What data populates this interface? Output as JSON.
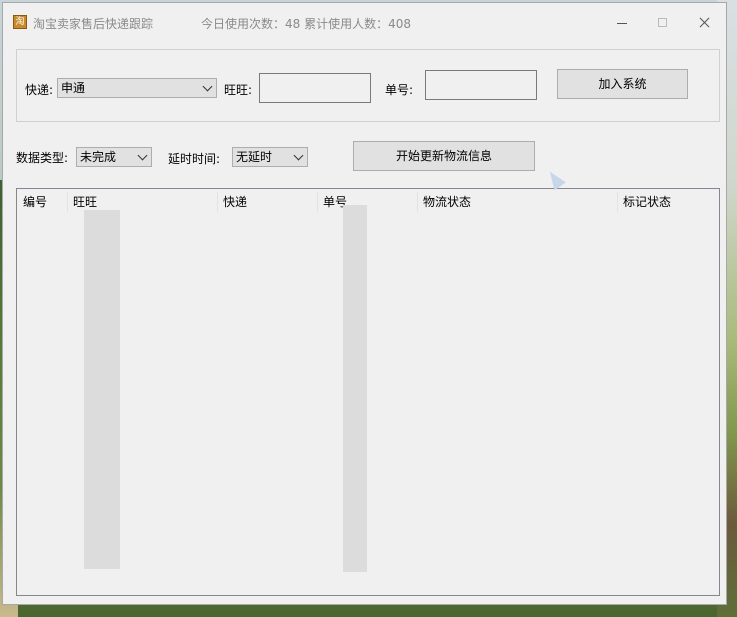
{
  "window": {
    "icon_glyph": "淘",
    "title": "淘宝卖家售后快递跟踪",
    "stats": "今日使用次数：48   累计使用人数：408",
    "controls": [
      "minimize-icon",
      "maximize-icon",
      "close-icon"
    ]
  },
  "form": {
    "express_label": "快递:",
    "express_value": "申通",
    "wangwang_label": "旺旺:",
    "wangwang_value": "",
    "tracking_label": "单号:",
    "tracking_value": "",
    "add_button": "加入系统"
  },
  "filters": {
    "data_type_label": "数据类型:",
    "data_type_value": "未完成",
    "delay_label": "延时时间:",
    "delay_value": "无延时",
    "update_button": "开始更新物流信息"
  },
  "table": {
    "columns": [
      "编号",
      "旺旺",
      "快递",
      "单号",
      "物流状态",
      "标记状态"
    ],
    "rows": []
  }
}
